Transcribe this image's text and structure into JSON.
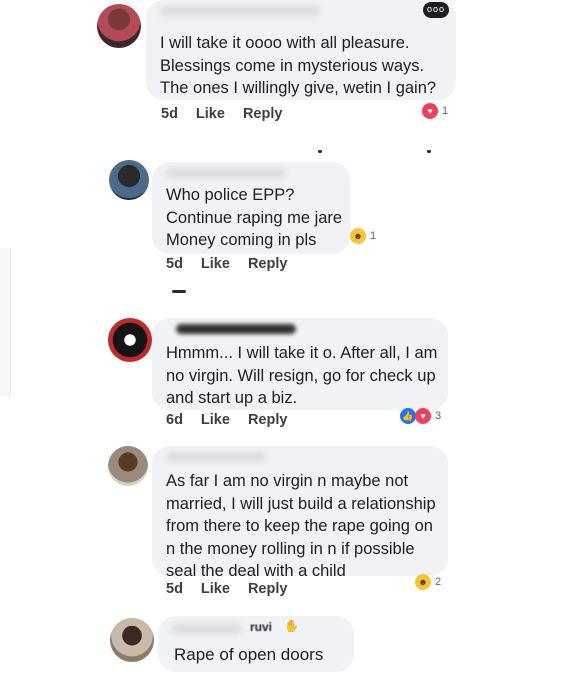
{
  "comments": [
    {
      "lines": "I will take it oooo with all pleasure.\nBlessings come in mysterious ways.\nThe ones I willingly give, wetin I gain?",
      "time": "5d",
      "like": "Like",
      "reply": "Reply",
      "reactions": [
        "love-icon"
      ],
      "reaction_count": "1"
    },
    {
      "lines": "Who police EPP?\nContinue raping me jare\nMoney coming in pls",
      "time": "5d",
      "like": "Like",
      "reply": "Reply",
      "reactions": [
        "haha-icon"
      ],
      "reaction_count": "1"
    },
    {
      "lines": "Hmmm... I will take it o. After all, I am\nno virgin. Will resign, go for check up\nand start up a biz.",
      "time": "6d",
      "like": "Like",
      "reply": "Reply",
      "reactions": [
        "like-icon",
        "love-icon"
      ],
      "reaction_count": "3"
    },
    {
      "lines": "As far I am no virgin n maybe not\nmarried, I will just build a relationship\nfrom there to keep the rape going on\nn the money rolling in n if possible\nseal the deal with a child",
      "time": "5d",
      "like": "Like",
      "reply": "Reply",
      "reactions": [
        "haha-icon"
      ],
      "reaction_count": "2"
    },
    {
      "lines": "Rape of open doors",
      "name_fragment": "ruvi"
    }
  ],
  "menu_glyph": "ooo",
  "colors": {
    "bubble": "#f0f2f5",
    "text": "#1c1e21",
    "love": "#f33e58",
    "like": "#1877f2",
    "haha": "#f7c534"
  }
}
